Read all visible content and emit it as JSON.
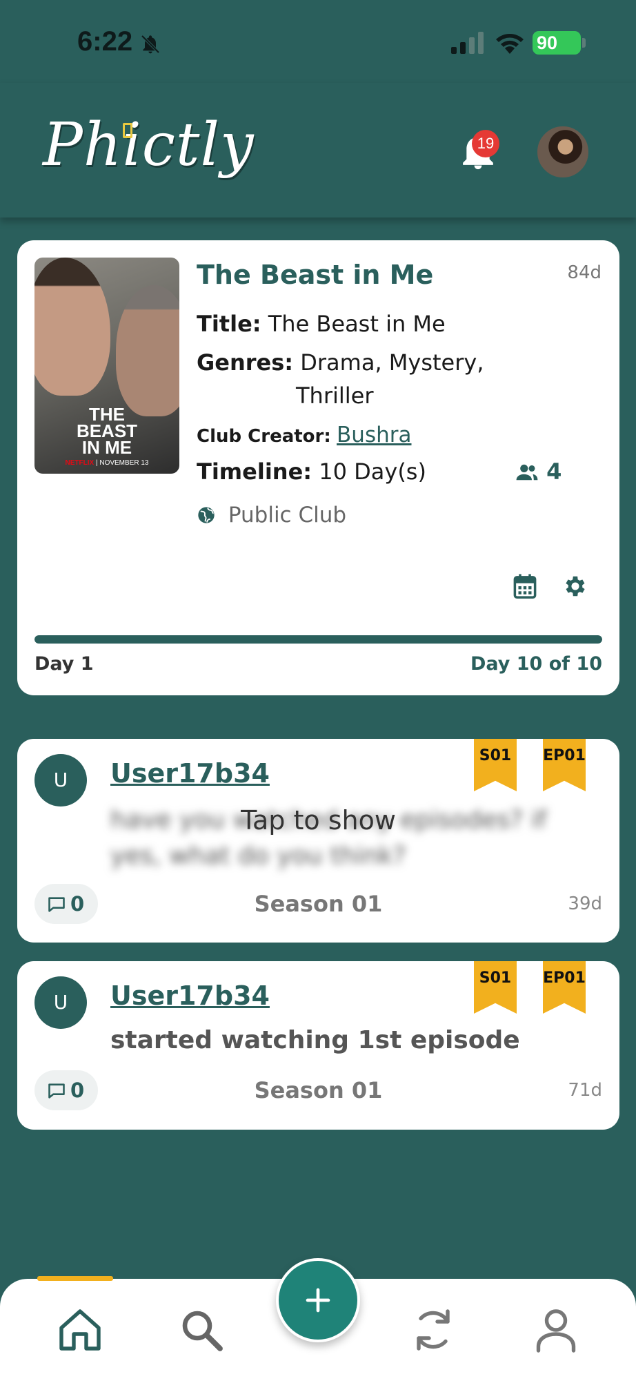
{
  "status_bar": {
    "time": "6:22",
    "battery": "90"
  },
  "header": {
    "logo": "Phictly",
    "notification_count": "19"
  },
  "club": {
    "title": "The Beast in Me",
    "age": "84d",
    "poster": {
      "title_line1": "THE",
      "title_line2": "BEAST",
      "title_line3": "IN ME",
      "footer_brand": "NETFLIX",
      "footer_date": "NOVEMBER 13"
    },
    "title_label": "Title:",
    "title_value": "The Beast in Me",
    "genres_label": "Genres:",
    "genres_value_line1": "Drama, Mystery,",
    "genres_value_line2": "Thriller",
    "creator_label": "Club Creator:",
    "creator_value": "Bushra",
    "timeline_label": "Timeline:",
    "timeline_value": "10 Day(s)",
    "members": "4",
    "visibility": "Public Club",
    "progress_fraction": 1.0,
    "day_start": "Day 1",
    "day_end": "Day 10 of 10"
  },
  "posts": [
    {
      "avatar_letter": "U",
      "user": "User17b34",
      "season_badge": "S01",
      "episode_badge": "EP01",
      "hidden_text": "have you watched any episodes? if yes, what do you think?",
      "reveal_label": "Tap to show",
      "comments": "0",
      "season": "Season 01",
      "age": "39d"
    },
    {
      "avatar_letter": "U",
      "user": "User17b34",
      "season_badge": "S01",
      "episode_badge": "EP01",
      "text": "started watching 1st episode",
      "comments": "0",
      "season": "Season 01",
      "age": "71d"
    }
  ],
  "colors": {
    "primary": "#2a5f5c",
    "accent": "#f2b01e",
    "fab": "#1f8378",
    "badge": "#e53935"
  },
  "nav": {
    "items": [
      "home-icon",
      "search-icon",
      "add-icon",
      "refresh-icon",
      "profile-icon"
    ]
  }
}
